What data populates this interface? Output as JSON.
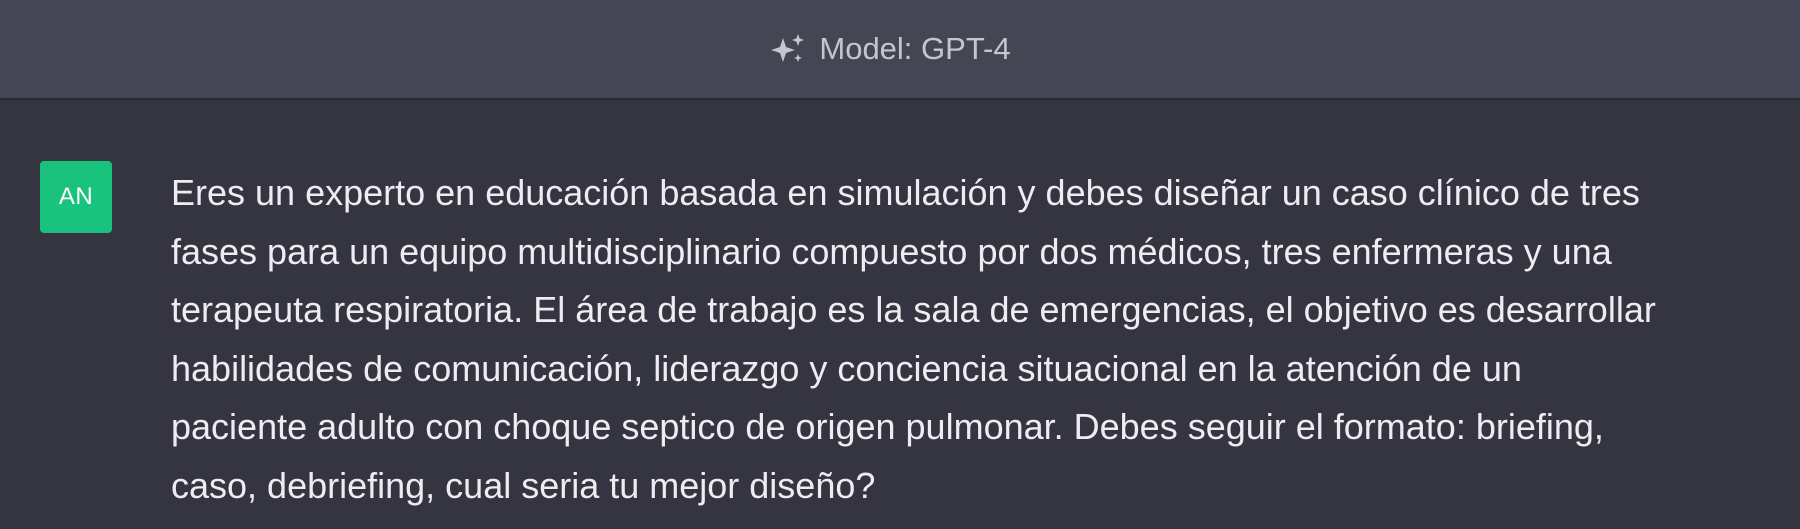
{
  "header": {
    "model_label": "Model: GPT-4",
    "icon": "sparkle-icon"
  },
  "message": {
    "avatar_initials": "AN",
    "avatar_color": "#19c37d",
    "text": "Eres un experto en educación basada en simulación y debes diseñar un caso clínico de tres\nfases para un equipo multidisciplinario compuesto por dos médicos, tres enfermeras y una\nterapeuta respiratoria. El área de trabajo es la sala de emergencias, el objetivo es desarrollar\nhabilidades de comunicación, liderazgo y conciencia situacional en la atención de un\npaciente adulto con choque septico de origen pulmonar. Debes seguir el formato: briefing,\ncaso, debriefing, cual seria tu mejor diseño?"
  },
  "colors": {
    "page_background": "#343541",
    "header_background": "#444654",
    "text": "#ececf1",
    "muted_text": "#c5c5d2"
  }
}
